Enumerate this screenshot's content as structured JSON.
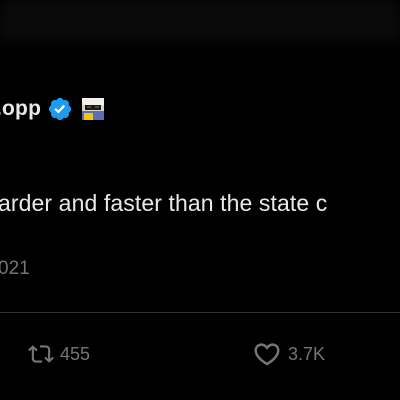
{
  "tweet": {
    "author_name": ".opp",
    "text": "arder and faster than the state c",
    "timestamp": "021",
    "retweets": "455",
    "likes": "3.7K"
  },
  "colors": {
    "background": "#000000",
    "text_primary": "#e7e9ea",
    "text_secondary": "#71767b",
    "verified_badge": "#1d9bf0",
    "divider": "#2f3336"
  },
  "icons": {
    "verified": "verified-badge-icon",
    "emoji": "sunglasses-emoji-icon",
    "retweet": "retweet-icon",
    "like": "heart-icon"
  }
}
